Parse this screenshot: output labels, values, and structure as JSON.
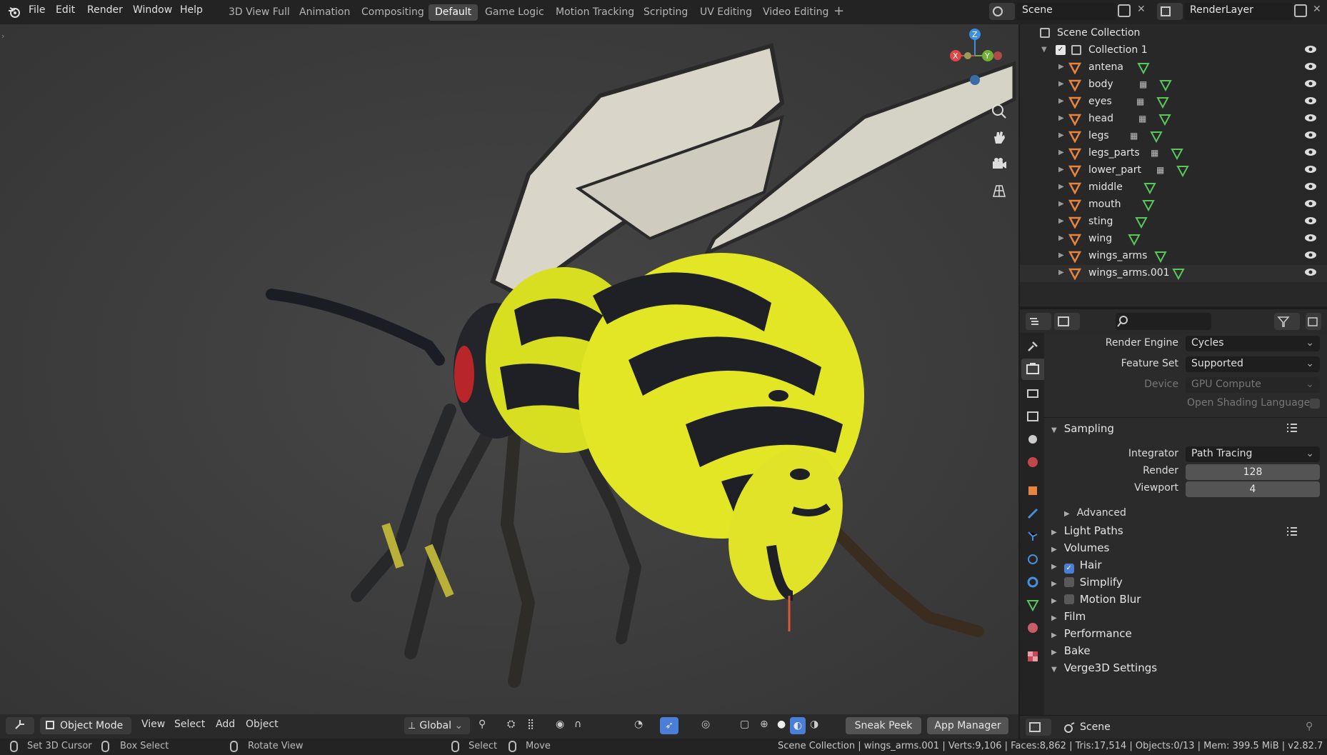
{
  "menus": [
    "File",
    "Edit",
    "Render",
    "Window",
    "Help"
  ],
  "workspaces": [
    "3D View Full",
    "Animation",
    "Compositing",
    "Default",
    "Game Logic",
    "Motion Tracking",
    "Scripting",
    "UV Editing",
    "Video Editing"
  ],
  "active_workspace": "Default",
  "scene_name": "Scene",
  "view_layer": "RenderLayer",
  "viewport": {
    "mode": "Object Mode",
    "menus": [
      "View",
      "Select",
      "Add",
      "Object"
    ],
    "orientation": "Global",
    "buttons": [
      "Sneak Peek",
      "App Manager"
    ],
    "gizmo": {
      "x": "X",
      "y": "Y",
      "z": "Z"
    }
  },
  "outliner": {
    "root": "Scene Collection",
    "collection": "Collection 1",
    "objects": [
      "antena",
      "body",
      "eyes",
      "head",
      "legs",
      "legs_parts",
      "lower_part",
      "middle",
      "mouth",
      "sting",
      "wing",
      "wings_arms",
      "wings_arms.001"
    ]
  },
  "properties": {
    "render_engine_label": "Render Engine",
    "render_engine": "Cycles",
    "feature_set_label": "Feature Set",
    "feature_set": "Supported",
    "device_label": "Device",
    "device": "GPU Compute",
    "osl_label": "Open Shading Language",
    "sampling": "Sampling",
    "integrator_label": "Integrator",
    "integrator": "Path Tracing",
    "render_label": "Render",
    "render_samples": "128",
    "viewport_label": "Viewport",
    "viewport_samples": "4",
    "advanced": "Advanced",
    "panels": [
      "Light Paths",
      "Volumes",
      "Hair",
      "Simplify",
      "Motion Blur",
      "Film",
      "Performance",
      "Bake",
      "Verge3D Settings"
    ],
    "hair_checked": true
  },
  "bottom_scene": "Scene",
  "status": {
    "left": [
      "Set 3D Cursor",
      "Box Select",
      "Rotate View",
      "Select",
      "Move"
    ],
    "info": "Scene Collection | wings_arms.001 | Verts:9,106 | Faces:8,862 | Tris:17,514 | Objects:0/13 | Mem: 399.5 MiB | v2.82.7"
  },
  "colors": {
    "accent": "#4b7ed6",
    "object_icon": "#e5843c",
    "mesh_icon": "#58c75a",
    "wasp_yellow": "#e3e624"
  }
}
